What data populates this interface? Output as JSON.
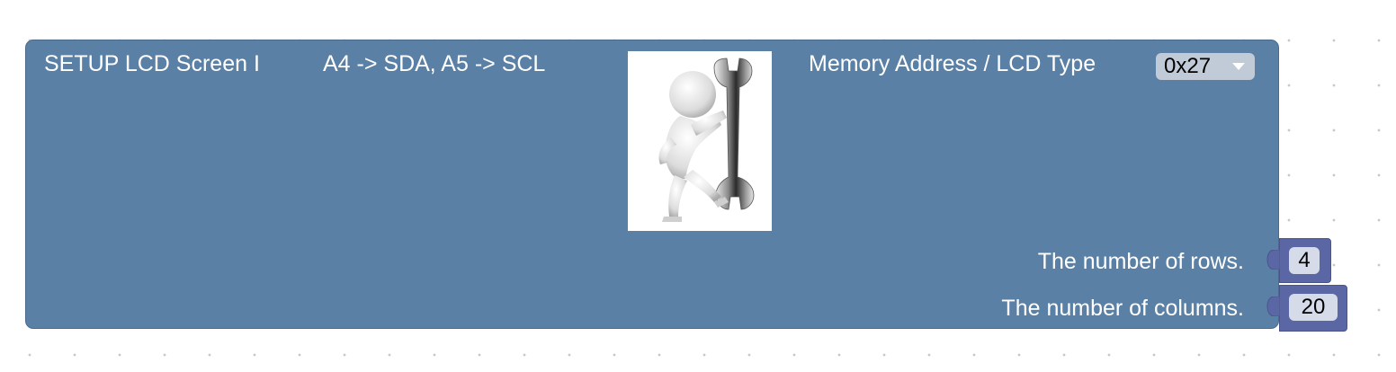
{
  "block": {
    "title": "SETUP LCD Screen I",
    "pins": "A4 -> SDA, A5 -> SCL",
    "memory_label": "Memory Address / LCD Type",
    "memory_value": "0x27",
    "rows_label": "The number of rows.",
    "rows_value": "4",
    "columns_label": "The number of columns.",
    "columns_value": "20"
  },
  "colors": {
    "block": "#5b80a5",
    "value_block": "#5b67a5",
    "field": "#d6dbe9"
  },
  "icons": {
    "setup_image": "person-with-wrench-icon",
    "dropdown": "chevron-down-icon"
  }
}
